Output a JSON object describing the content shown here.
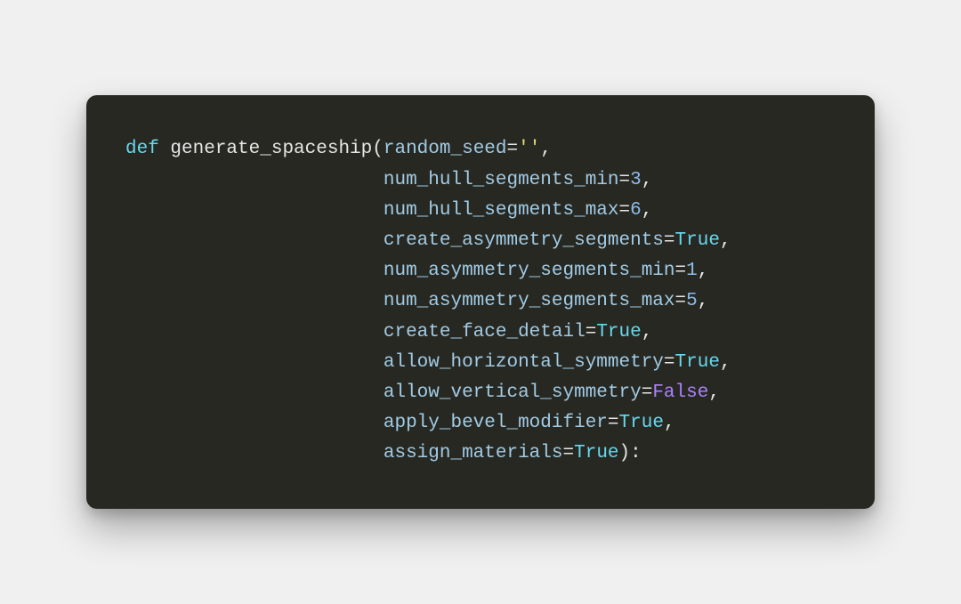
{
  "code": {
    "keyword_def": "def",
    "function_name": "generate_spaceship",
    "params": [
      {
        "name": "random_seed",
        "value": "''",
        "vtype": "str"
      },
      {
        "name": "num_hull_segments_min",
        "value": "3",
        "vtype": "num"
      },
      {
        "name": "num_hull_segments_max",
        "value": "6",
        "vtype": "num"
      },
      {
        "name": "create_asymmetry_segments",
        "value": "True",
        "vtype": "true"
      },
      {
        "name": "num_asymmetry_segments_min",
        "value": "1",
        "vtype": "num"
      },
      {
        "name": "num_asymmetry_segments_max",
        "value": "5",
        "vtype": "num"
      },
      {
        "name": "create_face_detail",
        "value": "True",
        "vtype": "true"
      },
      {
        "name": "allow_horizontal_symmetry",
        "value": "True",
        "vtype": "true"
      },
      {
        "name": "allow_vertical_symmetry",
        "value": "False",
        "vtype": "false"
      },
      {
        "name": "apply_bevel_modifier",
        "value": "True",
        "vtype": "true"
      },
      {
        "name": "assign_materials",
        "value": "True",
        "vtype": "true"
      }
    ],
    "indent": "                       "
  }
}
